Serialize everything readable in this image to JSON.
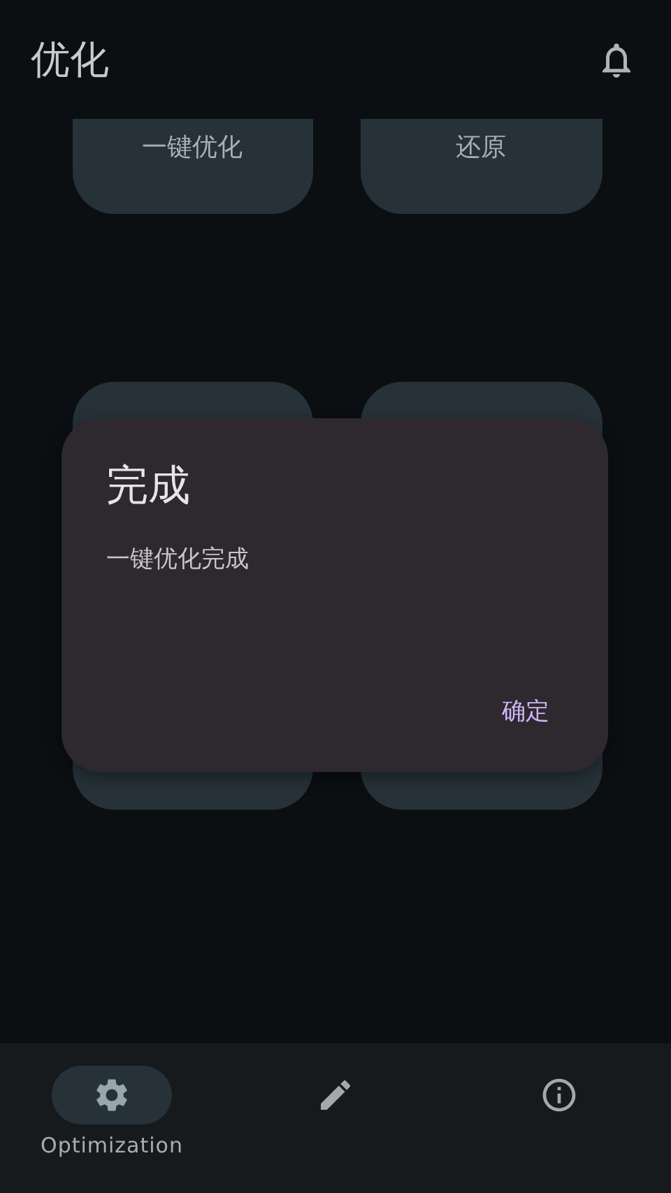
{
  "app_bar": {
    "title": "优化"
  },
  "cards": [
    {
      "label": "一键优化"
    },
    {
      "label": "还原"
    }
  ],
  "dialog": {
    "title": "完成",
    "message": "一键优化完成",
    "button": "确定"
  },
  "nav": [
    {
      "kind": "settings",
      "label": "Optimization",
      "selected": true
    },
    {
      "kind": "edit",
      "selected": false
    },
    {
      "kind": "about",
      "selected": false
    }
  ]
}
